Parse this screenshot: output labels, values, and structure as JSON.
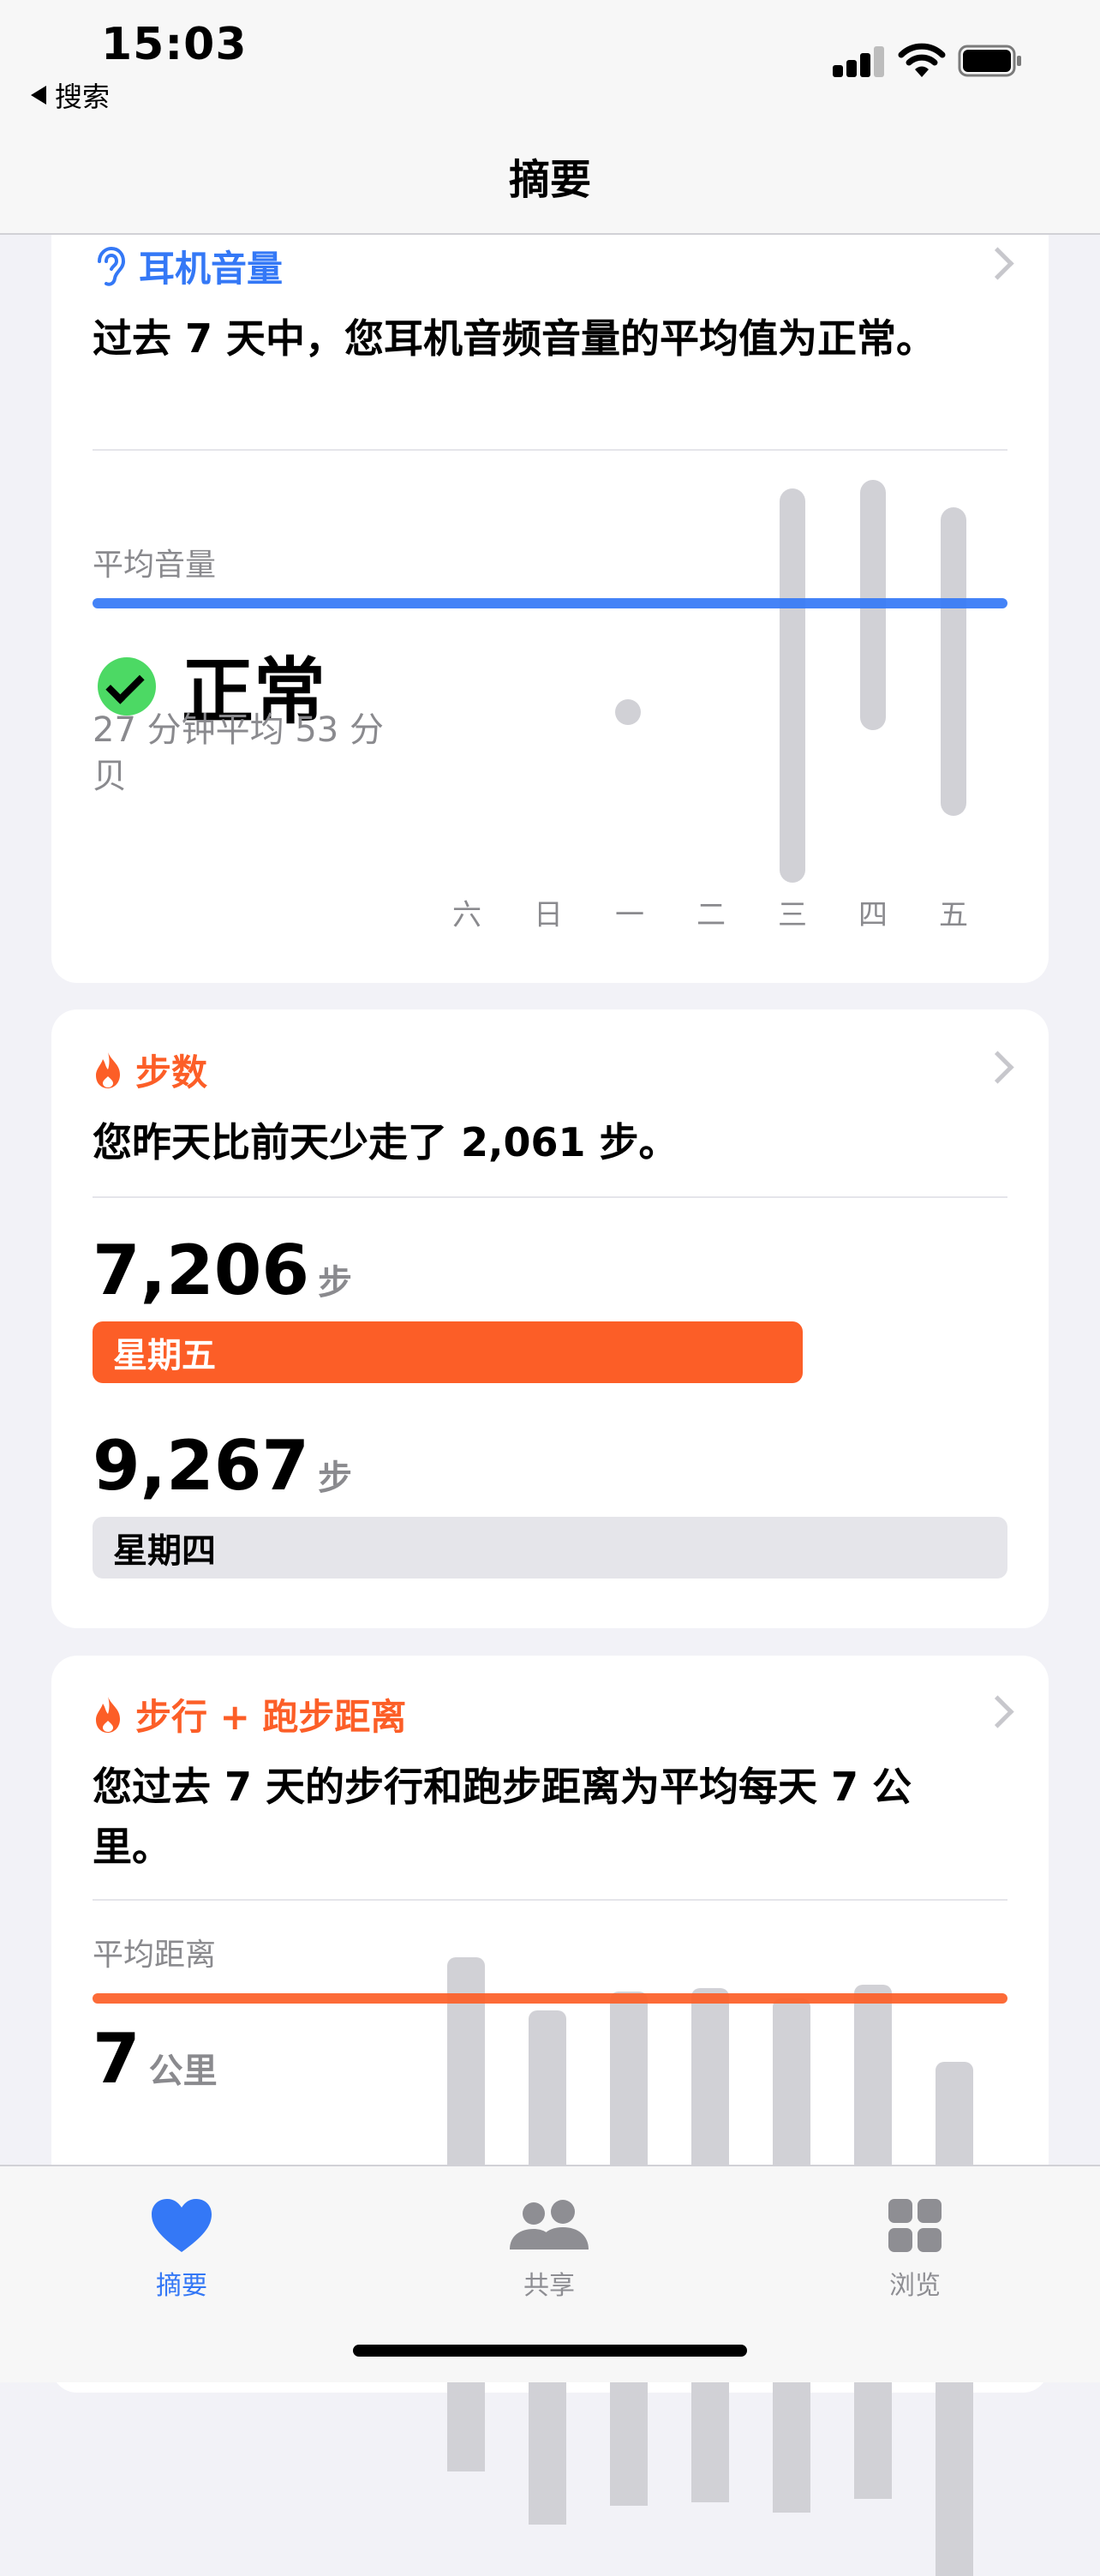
{
  "status": {
    "time": "15:03",
    "back": "搜索"
  },
  "nav": {
    "title": "摘要"
  },
  "colors": {
    "blue": "#3478f6",
    "orange": "#fc5e27",
    "gray_bar": "#d1d1d6",
    "green": "#4cd964"
  },
  "hearing": {
    "title": "耳机音量",
    "icon": "ear-icon",
    "summary": "过去 7 天中，您耳机音频音量的平均值为正常。",
    "avg_label": "平均音量",
    "status_word": "正常",
    "detail": "27 分钟平均 53 分贝",
    "days": [
      "六",
      "日",
      "一",
      "二",
      "三",
      "四",
      "五"
    ]
  },
  "steps": {
    "title": "步数",
    "icon": "flame-icon",
    "summary": "您昨天比前天少走了 2,061 步。",
    "rows": [
      {
        "value": "7,206",
        "unit": "步",
        "day": "星期五",
        "fraction": 0.7758
      },
      {
        "value": "9,267",
        "unit": "步",
        "day": "星期四",
        "fraction": 1.0
      }
    ]
  },
  "distance": {
    "title": "步行 + 跑步距离",
    "icon": "flame-icon",
    "summary": "您过去 7 天的步行和跑步距离为平均每天 7 公里。",
    "avg_label": "平均距离",
    "avg_value": "7",
    "avg_unit": "公里"
  },
  "tabs": [
    {
      "label": "摘要",
      "icon": "heart-icon",
      "active": true
    },
    {
      "label": "共享",
      "icon": "people-icon",
      "active": false
    },
    {
      "label": "浏览",
      "icon": "grid-icon",
      "active": false
    }
  ]
}
